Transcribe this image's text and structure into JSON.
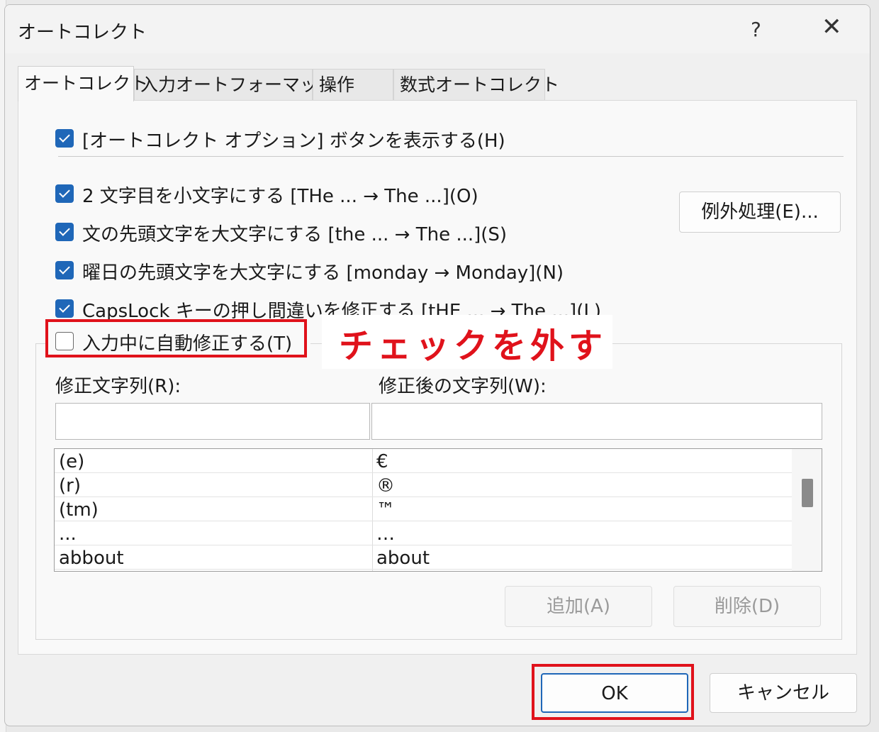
{
  "window": {
    "title": "オートコレクト",
    "help": "?",
    "close": "✕"
  },
  "tabs": [
    "オートコレクト",
    "入力オートフォーマット",
    "操作",
    "数式オートコレクト"
  ],
  "options": {
    "show_buttons": {
      "label": "[オートコレクト オプション] ボタンを表示する(H)",
      "checked": true
    },
    "two_initial": {
      "label": "2 文字目を小文字にする [THe ... → The ...](O)",
      "checked": true
    },
    "sentence_cap": {
      "label": "文の先頭文字を大文字にする [the ... → The ...](S)",
      "checked": true
    },
    "day_cap": {
      "label": "曜日の先頭文字を大文字にする [monday → Monday](N)",
      "checked": true
    },
    "capslock": {
      "label": "CapsLock キーの押し間違いを修正する [tHE ... → The ...](L)",
      "checked": true
    },
    "replace_as_type": {
      "label": "入力中に自動修正する(T)",
      "checked": false
    }
  },
  "exceptions_button": "例外処理(E)...",
  "replace": {
    "replace_label": "修正文字列(R):",
    "with_label": "修正後の文字列(W):",
    "replace_value": "",
    "with_value": "",
    "entries": [
      {
        "from": "(e)",
        "to": "€"
      },
      {
        "from": "(r)",
        "to": "®"
      },
      {
        "from": "(tm)",
        "to": "™"
      },
      {
        "from": "...",
        "to": "…"
      },
      {
        "from": "abbout",
        "to": "about"
      }
    ],
    "add_button": "追加(A)",
    "delete_button": "削除(D)"
  },
  "footer": {
    "ok": "OK",
    "cancel": "キャンセル"
  },
  "annotation": {
    "text": "チェックを外す",
    "color": "#e0121b"
  }
}
